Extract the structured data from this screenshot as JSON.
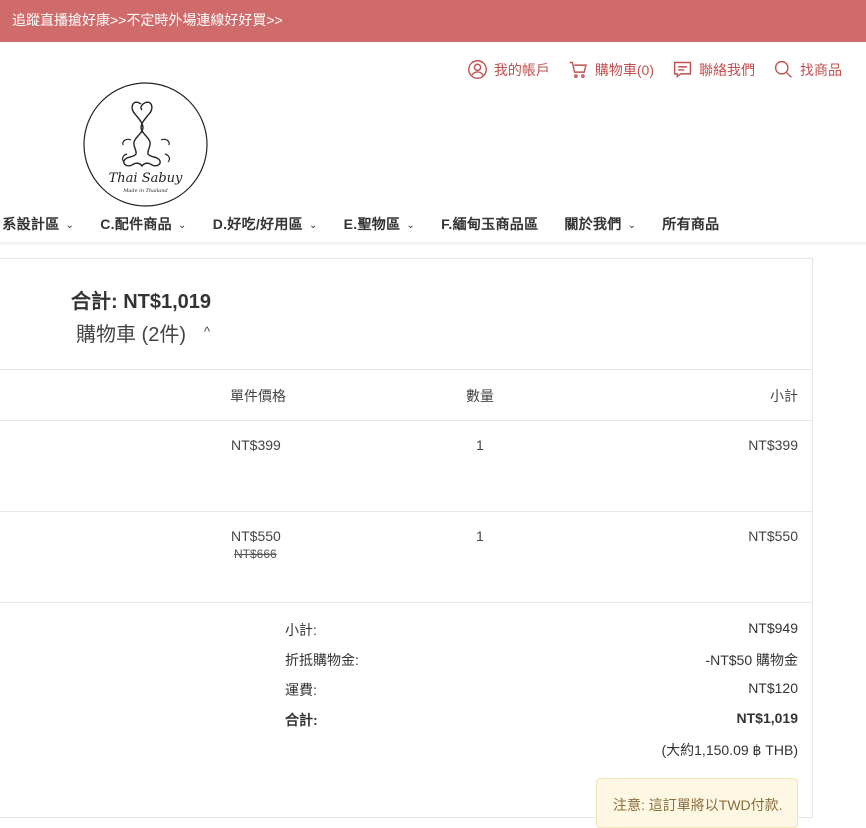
{
  "banner": {
    "text": "追蹤直播搶好康>>不定時外場連線好好買>>"
  },
  "toplinks": {
    "account": "我的帳戶",
    "cart": "購物車(0)",
    "contact": "聯絡我們",
    "search": "找商品"
  },
  "logo": {
    "alt": "Thai Sabuy Made in Thailand"
  },
  "nav": {
    "items": [
      {
        "label": "日系設計區"
      },
      {
        "label": "C.配件商品"
      },
      {
        "label": "D.好吃/好用區"
      },
      {
        "label": "E.聖物區"
      },
      {
        "label": "F.緬甸玉商品區"
      },
      {
        "label": "關於我們"
      },
      {
        "label": "所有商品"
      }
    ]
  },
  "summary": {
    "total_heading": "合計: NT$1,019",
    "cart_toggle": "購物車 (2件)"
  },
  "table": {
    "headers": {
      "unit_price": "單件價格",
      "qty": "數量",
      "subtotal": "小計"
    },
    "rows": [
      {
        "price": "NT$399",
        "qty": "1",
        "subtotal": "NT$399"
      },
      {
        "price": "NT$550",
        "original_price": "NT$666",
        "qty": "1",
        "subtotal": "NT$550"
      }
    ]
  },
  "totals": {
    "subtotal_label": "小計:",
    "subtotal_value": "NT$949",
    "credit_label": "折抵購物金:",
    "credit_value": "-NT$50 購物金",
    "shipping_label": "運費:",
    "shipping_value": "NT$120",
    "total_label": "合計:",
    "total_value": "NT$1,019",
    "thb_value": "(大約1,150.09 ฿ THB)"
  },
  "notice": {
    "text": "注意: 這訂單將以TWD付款."
  },
  "colors": {
    "banner": "#cf6b6b",
    "accent": "#c1504f",
    "notice_bg": "#fdf7e3"
  }
}
